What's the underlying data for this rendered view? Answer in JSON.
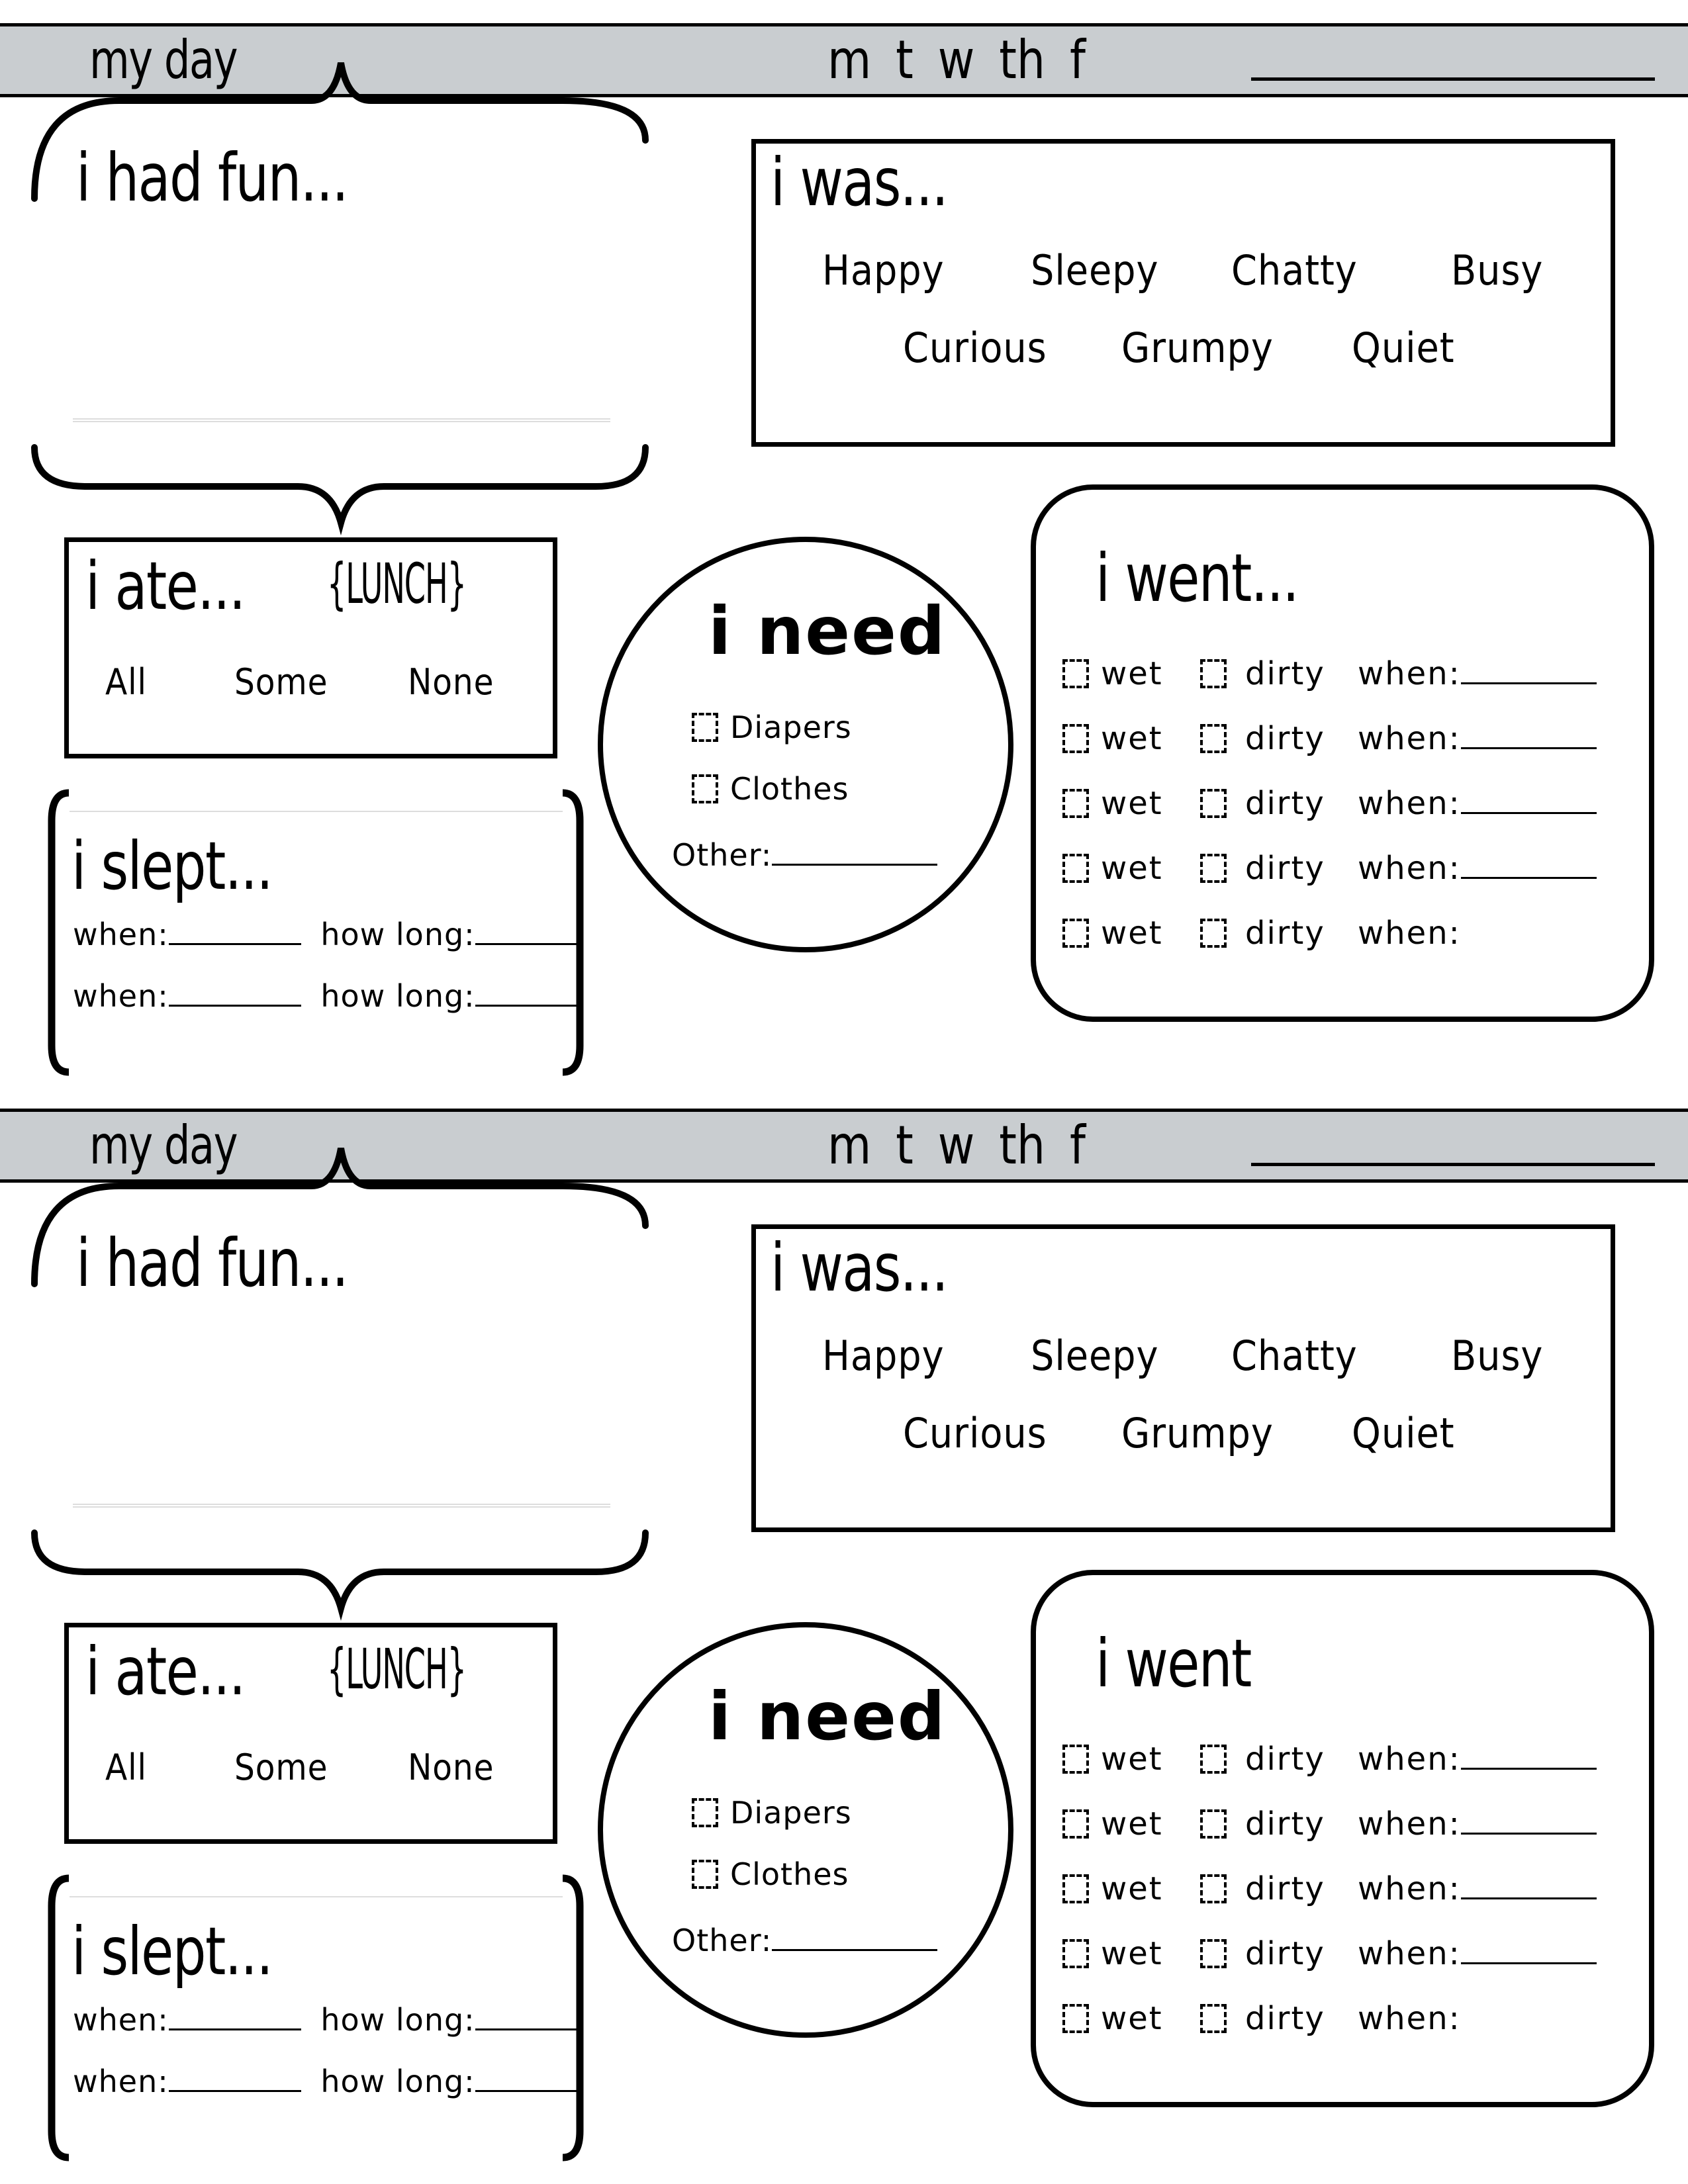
{
  "sections": [
    {
      "header": {
        "title": "my day",
        "days": "m t w th f",
        "date_blank": ""
      },
      "fun": {
        "title": "i had fun..."
      },
      "mood": {
        "title": "i was...",
        "row1": [
          "Happy",
          "Sleepy",
          "Chatty",
          "Busy"
        ],
        "row2": [
          "Curious",
          "Grumpy",
          "Quiet"
        ]
      },
      "ate": {
        "title": "i ate...",
        "meal": "{LUNCH}",
        "options": [
          "All",
          "Some",
          "None"
        ]
      },
      "slept": {
        "title": "i slept...",
        "rows": [
          {
            "when": "when:",
            "how_long": "how long:"
          },
          {
            "when": "when:",
            "how_long": "how long:"
          }
        ]
      },
      "need": {
        "title": "i need",
        "items": [
          "Diapers",
          "Clothes"
        ],
        "other": "Other:"
      },
      "went": {
        "title": "i went...",
        "wet": "wet",
        "dirty": "dirty",
        "when": "when:",
        "rows": 5
      }
    },
    {
      "header": {
        "title": "my day",
        "days": "m t w th f",
        "date_blank": ""
      },
      "fun": {
        "title": "i had fun..."
      },
      "mood": {
        "title": "i was...",
        "row1": [
          "Happy",
          "Sleepy",
          "Chatty",
          "Busy"
        ],
        "row2": [
          "Curious",
          "Grumpy",
          "Quiet"
        ]
      },
      "ate": {
        "title": "i ate...",
        "meal": "{LUNCH}",
        "options": [
          "All",
          "Some",
          "None"
        ]
      },
      "slept": {
        "title": "i slept...",
        "rows": [
          {
            "when": "when:",
            "how_long": "how long:"
          },
          {
            "when": "when:",
            "how_long": "how long:"
          }
        ]
      },
      "need": {
        "title": "i need",
        "items": [
          "Diapers",
          "Clothes"
        ],
        "other": "Other:"
      },
      "went": {
        "title": "i went",
        "wet": "wet",
        "dirty": "dirty",
        "when": "when:",
        "rows": 5
      }
    }
  ],
  "colors": {
    "header_bg": "#c9cdd0",
    "ink": "#000000"
  }
}
